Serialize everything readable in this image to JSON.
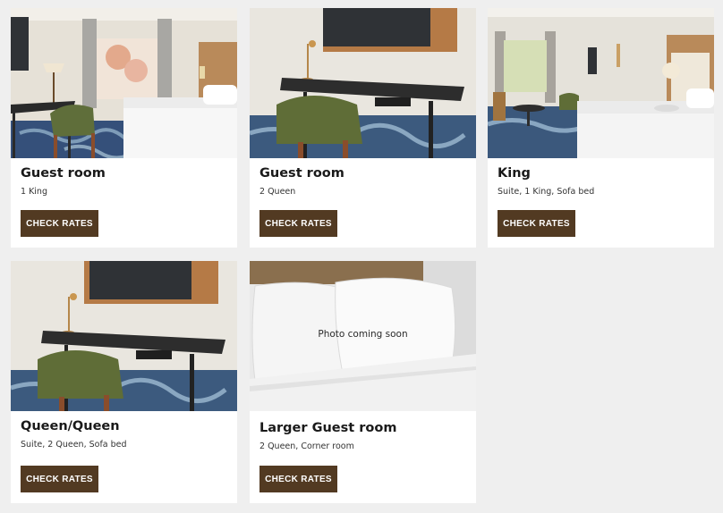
{
  "rooms": [
    {
      "title": "Guest room",
      "subtitle": "1 King",
      "button_label": "CHECK RATES"
    },
    {
      "title": "Guest room",
      "subtitle": "2 Queen",
      "button_label": "CHECK RATES"
    },
    {
      "title": "King",
      "subtitle": "Suite, 1 King, Sofa bed",
      "button_label": "CHECK RATES"
    },
    {
      "title": "Queen/Queen",
      "subtitle": "Suite, 2 Queen, Sofa bed",
      "button_label": "CHECK RATES"
    },
    {
      "title": "Larger Guest room",
      "subtitle": "2 Queen, Corner room",
      "button_label": "CHECK RATES",
      "photo_overlay": "Photo coming soon"
    }
  ],
  "colors": {
    "button_bg": "#523a22",
    "page_bg": "#efefef",
    "card_bg": "#ffffff"
  }
}
